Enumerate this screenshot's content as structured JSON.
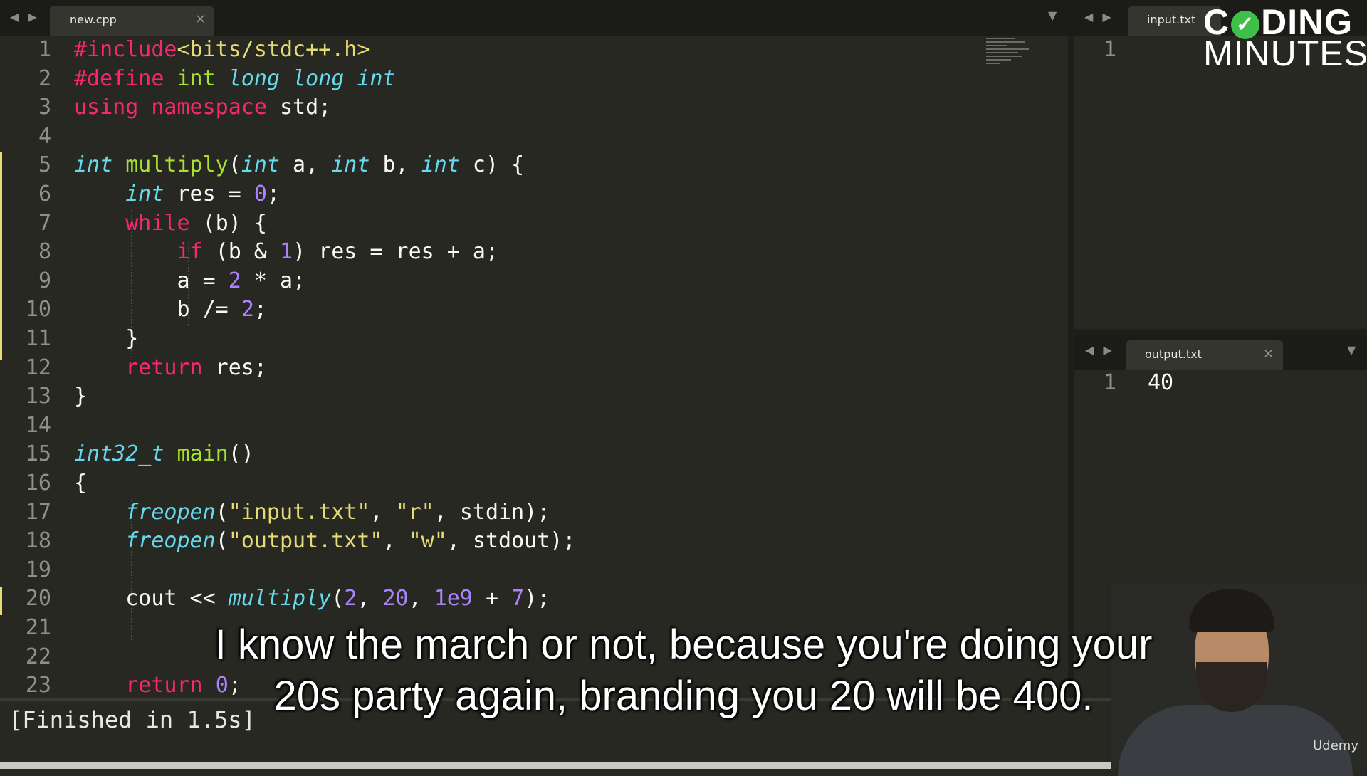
{
  "left_pane": {
    "tab": {
      "label": "new.cpp",
      "close": "×"
    },
    "nav_arrows": "◀ ▶",
    "dropdown": "▼"
  },
  "code_lines": [
    {
      "n": "1",
      "tokens": [
        [
          "pp",
          "#include"
        ],
        [
          "st",
          "<bits/stdc++.h>"
        ]
      ]
    },
    {
      "n": "2",
      "tokens": [
        [
          "pp",
          "#define"
        ],
        [
          "plain",
          " "
        ],
        [
          "fn",
          "int"
        ],
        [
          "plain",
          " "
        ],
        [
          "ty",
          "long long int"
        ]
      ]
    },
    {
      "n": "3",
      "tokens": [
        [
          "kw",
          "using"
        ],
        [
          "plain",
          " "
        ],
        [
          "kw",
          "namespace"
        ],
        [
          "plain",
          " std;"
        ]
      ]
    },
    {
      "n": "4",
      "tokens": []
    },
    {
      "n": "5",
      "tokens": [
        [
          "ty",
          "int"
        ],
        [
          "plain",
          " "
        ],
        [
          "fn",
          "multiply"
        ],
        [
          "plain",
          "("
        ],
        [
          "ty",
          "int"
        ],
        [
          "plain",
          " a, "
        ],
        [
          "ty",
          "int"
        ],
        [
          "plain",
          " b, "
        ],
        [
          "ty",
          "int"
        ],
        [
          "plain",
          " c) {"
        ]
      ]
    },
    {
      "n": "6",
      "tokens": [
        [
          "plain",
          "    "
        ],
        [
          "ty",
          "int"
        ],
        [
          "plain",
          " res = "
        ],
        [
          "nm",
          "0"
        ],
        [
          "plain",
          ";"
        ]
      ]
    },
    {
      "n": "7",
      "tokens": [
        [
          "plain",
          "    "
        ],
        [
          "kw",
          "while"
        ],
        [
          "plain",
          " (b) {"
        ]
      ]
    },
    {
      "n": "8",
      "tokens": [
        [
          "plain",
          "        "
        ],
        [
          "kw",
          "if"
        ],
        [
          "plain",
          " (b & "
        ],
        [
          "nm",
          "1"
        ],
        [
          "plain",
          ") res = res + a;"
        ]
      ]
    },
    {
      "n": "9",
      "tokens": [
        [
          "plain",
          "        a = "
        ],
        [
          "nm",
          "2"
        ],
        [
          "plain",
          " * a;"
        ]
      ]
    },
    {
      "n": "10",
      "tokens": [
        [
          "plain",
          "        b /= "
        ],
        [
          "nm",
          "2"
        ],
        [
          "plain",
          ";"
        ]
      ]
    },
    {
      "n": "11",
      "tokens": [
        [
          "plain",
          "    }"
        ]
      ]
    },
    {
      "n": "12",
      "tokens": [
        [
          "plain",
          "    "
        ],
        [
          "kw",
          "return"
        ],
        [
          "plain",
          " res;"
        ]
      ]
    },
    {
      "n": "13",
      "tokens": [
        [
          "plain",
          "}"
        ]
      ]
    },
    {
      "n": "14",
      "tokens": []
    },
    {
      "n": "15",
      "tokens": [
        [
          "ty",
          "int32_t"
        ],
        [
          "plain",
          " "
        ],
        [
          "fn",
          "main"
        ],
        [
          "plain",
          "()"
        ]
      ]
    },
    {
      "n": "16",
      "tokens": [
        [
          "plain",
          "{"
        ]
      ]
    },
    {
      "n": "17",
      "tokens": [
        [
          "plain",
          "    "
        ],
        [
          "ty",
          "freopen"
        ],
        [
          "plain",
          "("
        ],
        [
          "st",
          "\"input.txt\""
        ],
        [
          "plain",
          ", "
        ],
        [
          "st",
          "\"r\""
        ],
        [
          "plain",
          ", stdin);"
        ]
      ]
    },
    {
      "n": "18",
      "tokens": [
        [
          "plain",
          "    "
        ],
        [
          "ty",
          "freopen"
        ],
        [
          "plain",
          "("
        ],
        [
          "st",
          "\"output.txt\""
        ],
        [
          "plain",
          ", "
        ],
        [
          "st",
          "\"w\""
        ],
        [
          "plain",
          ", stdout);"
        ]
      ]
    },
    {
      "n": "19",
      "tokens": []
    },
    {
      "n": "20",
      "tokens": [
        [
          "plain",
          "    cout << "
        ],
        [
          "ty",
          "multiply"
        ],
        [
          "plain",
          "("
        ],
        [
          "nm",
          "2"
        ],
        [
          "plain",
          ", "
        ],
        [
          "nm",
          "20"
        ],
        [
          "plain",
          ", "
        ],
        [
          "nm",
          "1e9"
        ],
        [
          "plain",
          " + "
        ],
        [
          "nm",
          "7"
        ],
        [
          "plain",
          ");"
        ]
      ]
    },
    {
      "n": "21",
      "tokens": []
    },
    {
      "n": "22",
      "tokens": []
    },
    {
      "n": "23",
      "tokens": [
        [
          "plain",
          "    "
        ],
        [
          "kw",
          "return"
        ],
        [
          "plain",
          " "
        ],
        [
          "nm",
          "0"
        ],
        [
          "plain",
          ";"
        ]
      ]
    }
  ],
  "input_pane": {
    "tab": {
      "label": "input.txt"
    },
    "nav_arrows": "◀ ▶",
    "lines": [
      {
        "n": "1",
        "text": ""
      }
    ]
  },
  "output_pane": {
    "tab": {
      "label": "output.txt",
      "close": "×"
    },
    "nav_arrows": "◀ ▶",
    "dropdown": "▼",
    "lines": [
      {
        "n": "1",
        "text": "40"
      }
    ]
  },
  "console": {
    "text": "[Finished in 1.5s]"
  },
  "overlay": {
    "logo_top_a": "C",
    "logo_top_b": "DING",
    "logo_check": "✓",
    "logo_bottom": "MINUTES",
    "subtitle_line1": "I know the march or not, because you're doing your",
    "subtitle_line2": "20s party again, branding you 20 will be 400.",
    "watermark": "Udemy"
  }
}
